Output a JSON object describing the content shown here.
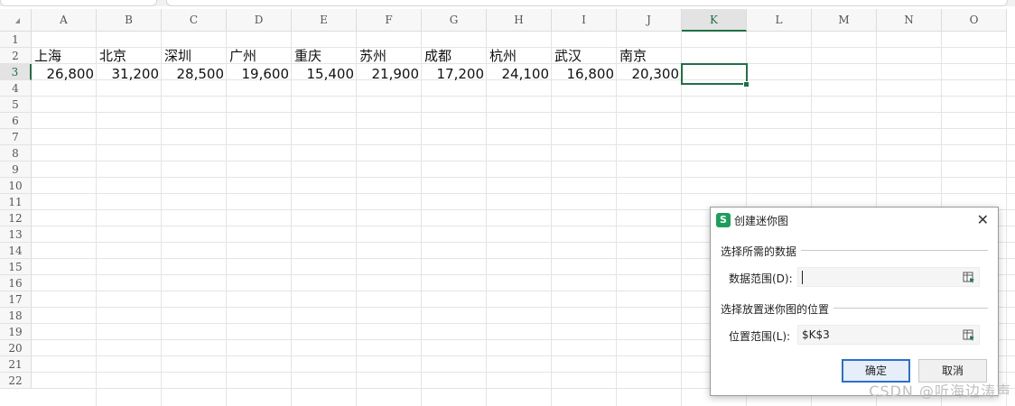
{
  "columns": [
    "A",
    "B",
    "C",
    "D",
    "E",
    "F",
    "G",
    "H",
    "I",
    "J",
    "K",
    "L",
    "M",
    "N",
    "O"
  ],
  "rows": [
    "1",
    "2",
    "3",
    "4",
    "5",
    "6",
    "7",
    "8",
    "9",
    "10",
    "11",
    "12",
    "13",
    "14",
    "15",
    "16",
    "17",
    "18",
    "19",
    "20",
    "21",
    "22"
  ],
  "selected_column": "K",
  "selected_row": "3",
  "cities": [
    "上海",
    "北京",
    "深圳",
    "广州",
    "重庆",
    "苏州",
    "成都",
    "杭州",
    "武汉",
    "南京"
  ],
  "values": [
    "26,800",
    "31,200",
    "28,500",
    "19,600",
    "15,400",
    "21,900",
    "17,200",
    "24,100",
    "16,800",
    "20,300"
  ],
  "dialog": {
    "title": "创建迷你图",
    "close_glyph": "✕",
    "app_icon_letter": "S",
    "section1": "选择所需的数据",
    "data_range_label": "数据范围(D):",
    "data_range_value": "",
    "section2": "选择放置迷你图的位置",
    "location_range_label": "位置范围(L):",
    "location_range_value": "$K$3",
    "ok_label": "确定",
    "cancel_label": "取消"
  },
  "watermark": "CSDN @听海边涛声"
}
